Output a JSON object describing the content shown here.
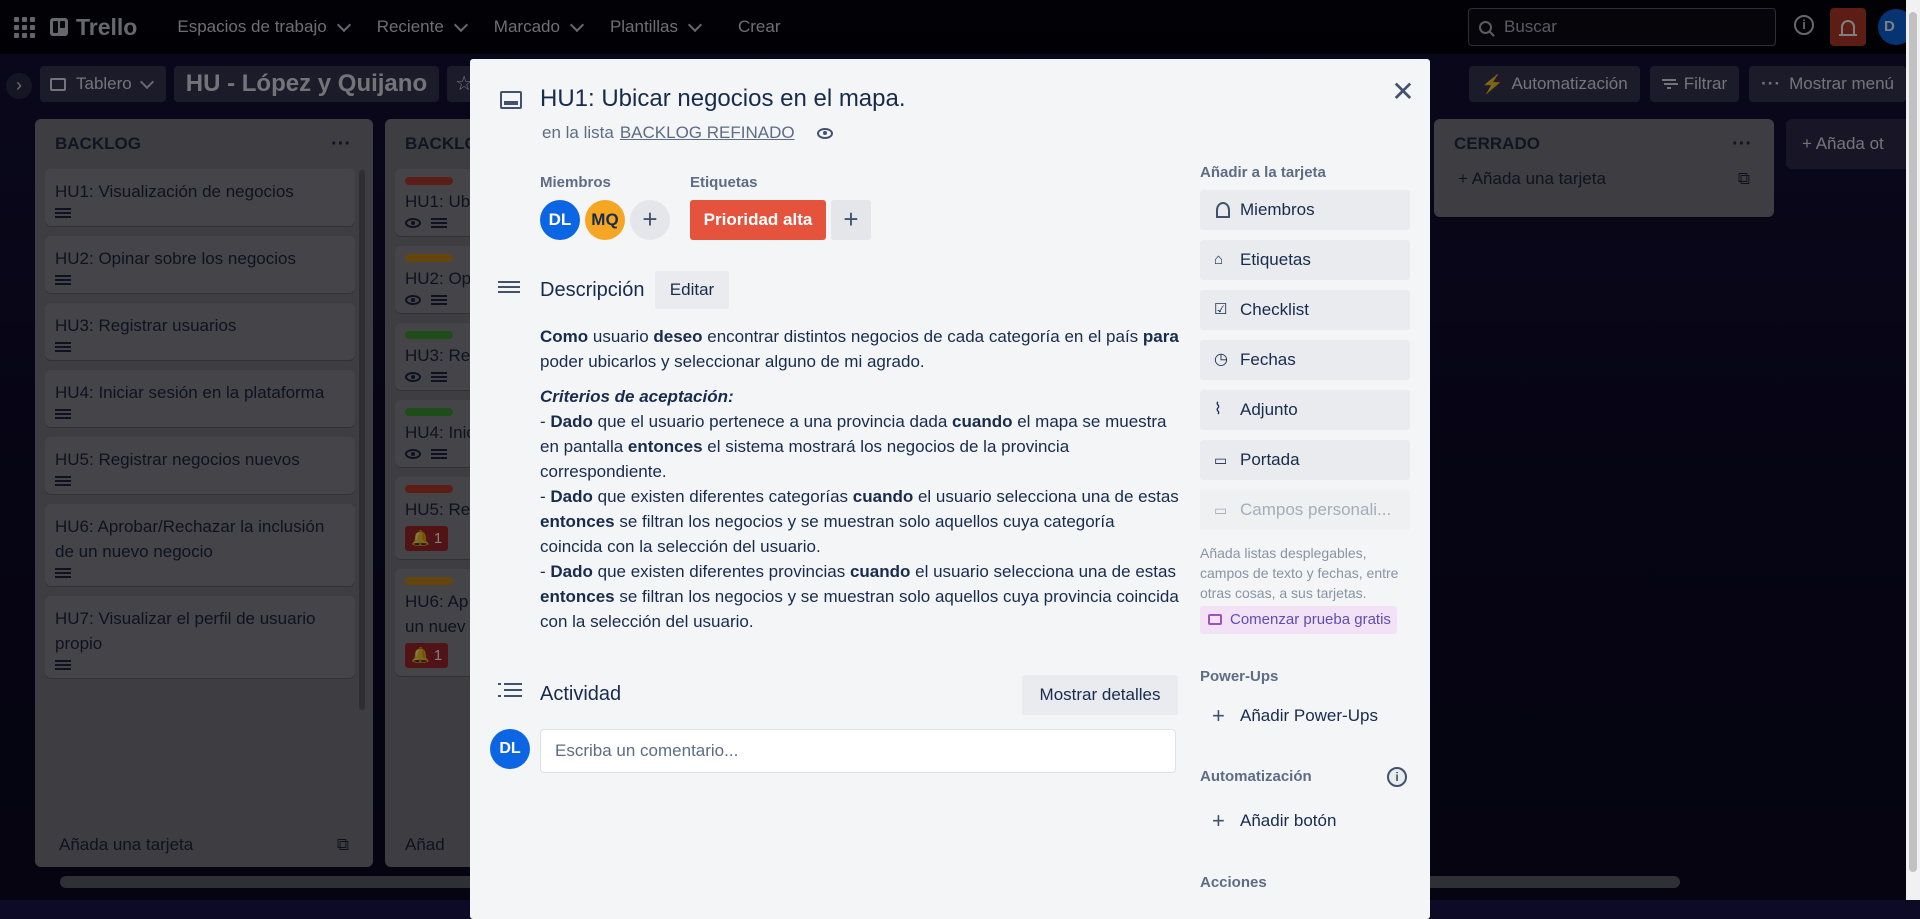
{
  "topbar": {
    "brand": "Trello",
    "nav": [
      "Espacios de trabajo",
      "Reciente",
      "Marcado",
      "Plantillas"
    ],
    "create": "Crear",
    "search_placeholder": "Buscar",
    "avatar_initials": "D"
  },
  "board": {
    "view": "Tablero",
    "title": "HU - López y Quijano",
    "automation": "Automatización",
    "filter": "Filtrar",
    "menu": "Mostrar menú",
    "add_list": "Añada ot"
  },
  "lists": {
    "backlog": {
      "title": "BACKLOG",
      "cards": [
        "HU1: Visualización de negocios",
        "HU2: Opinar sobre los negocios",
        "HU3: Registrar usuarios",
        "HU4: Iniciar sesión en la plataforma",
        "HU5: Registrar negocios nuevos",
        "HU6: Aprobar/Rechazar la inclusión de un nuevo negocio",
        "HU7: Visualizar el perfil de usuario propio"
      ],
      "add_card": "Añada una tarjeta"
    },
    "backlog_refinado": {
      "title": "BACKLO",
      "cards": [
        "HU1: Ub",
        "HU2: Op",
        "HU3: Re",
        "HU4: Inic",
        "HU5: Reg",
        "HU6: Ap"
      ],
      "card6_line2": "un nuev",
      "badge_count": "1",
      "add_card": "Añad",
      "label_colors": [
        "#b83a2c",
        "#c98a16",
        "#3f9a33",
        "#3f9a33",
        "#b83a2c",
        "#c98a16"
      ]
    },
    "cerrado": {
      "title": "CERRADO",
      "add_card": "Añada una tarjeta"
    }
  },
  "modal": {
    "title": "HU1: Ubicar negocios en el mapa.",
    "in_list_prefix": "en la lista",
    "list_name": "BACKLOG REFINADO",
    "members_label": "Miembros",
    "members": [
      {
        "initials": "DL",
        "color": "#0c66e4"
      },
      {
        "initials": "MQ",
        "color": "#f5a623"
      }
    ],
    "labels_label": "Etiquetas",
    "label_chip": "Prioridad alta",
    "label_color": "#e5533c",
    "description_title": "Descripción",
    "edit": "Editar",
    "desc": {
      "p1": {
        "b1": "Como",
        "t1": " usuario ",
        "b2": "deseo",
        "t2": " encontrar distintos negocios de cada categoría en el país ",
        "b3": "para",
        "t3": " poder ubicarlos y seleccionar alguno de mi agrado."
      },
      "criteria": "Criterios de aceptación:",
      "c1": {
        "pre": "- ",
        "b1": "Dado",
        "t1": " que el usuario pertenece a una provincia dada ",
        "b2": "cuando",
        "t2": " el mapa se muestra en pantalla ",
        "b3": "entonces",
        "t3": " el sistema mostrará los negocios de la provincia correspondiente."
      },
      "c2": {
        "pre": "- ",
        "b1": "Dado",
        "t1": " que existen diferentes categorías ",
        "b2": "cuando",
        "t2": " el usuario selecciona una de estas ",
        "b3": "entonces",
        "t3": " se filtran los negocios y se muestran solo aquellos cuya categoría coincida con la selección del usuario."
      },
      "c3": {
        "pre": "- ",
        "b1": "Dado",
        "t1": " que existen diferentes provincias ",
        "b2": "cuando",
        "t2": " el usuario selecciona una de estas ",
        "b3": "entonces",
        "t3": " se filtran los negocios y se muestran solo aquellos cuya provincia coincida con la selección del usuario."
      }
    },
    "activity_title": "Actividad",
    "show_details": "Mostrar detalles",
    "comment_avatar": "DL",
    "comment_placeholder": "Escriba un comentario...",
    "sidebar": {
      "add_to_card": "Añadir a la tarjeta",
      "buttons": [
        "Miembros",
        "Etiquetas",
        "Checklist",
        "Fechas",
        "Adjunto",
        "Portada",
        "Campos personali..."
      ],
      "promo": "Añada listas desplegables, campos de texto y fechas, entre otras cosas, a sus tarjetas.",
      "trial": "Comenzar prueba gratis",
      "powerups_label": "Power-Ups",
      "add_powerups": "Añadir Power-Ups",
      "automation_label": "Automatización",
      "add_button": "Añadir botón",
      "actions_label": "Acciones"
    }
  }
}
